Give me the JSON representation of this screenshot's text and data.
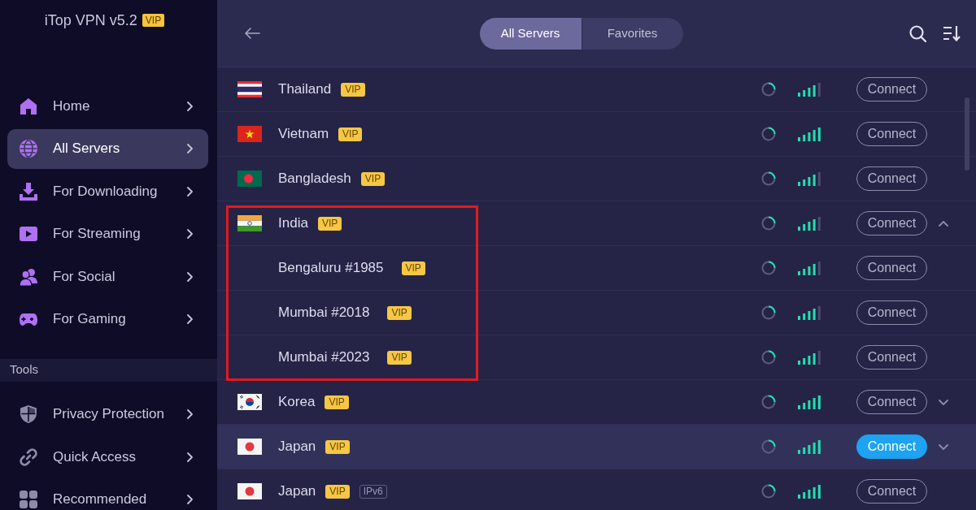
{
  "app": {
    "title": "iTop VPN v5.2",
    "badge": "VIP"
  },
  "sidebar": {
    "items": [
      {
        "label": "Home",
        "selected": false
      },
      {
        "label": "All Servers",
        "selected": true
      },
      {
        "label": "For Downloading",
        "selected": false
      },
      {
        "label": "For Streaming",
        "selected": false
      },
      {
        "label": "For Social",
        "selected": false
      },
      {
        "label": "For Gaming",
        "selected": false
      }
    ]
  },
  "tools": {
    "heading": "Tools",
    "items": [
      {
        "label": "Privacy Protection",
        "selected": false
      },
      {
        "label": "Quick Access",
        "selected": false
      },
      {
        "label": "Recommended",
        "selected": false
      }
    ]
  },
  "toolbar": {
    "tabs": [
      {
        "label": "All Servers",
        "selected": true
      },
      {
        "label": "Favorites",
        "selected": false
      }
    ]
  },
  "servers": [
    {
      "name": "Thailand",
      "tags": [
        {
          "kind": "vip",
          "label": "VIP"
        }
      ],
      "full_signal": false,
      "hovered": false,
      "outlined": false,
      "action": "Connect"
    },
    {
      "name": "Vietnam",
      "tags": [
        {
          "kind": "vip",
          "label": "VIP"
        }
      ],
      "full_signal": true,
      "hovered": false,
      "outlined": false,
      "action": "Connect"
    },
    {
      "name": "Bangladesh",
      "tags": [
        {
          "kind": "vip",
          "label": "VIP"
        }
      ],
      "full_signal": false,
      "hovered": false,
      "outlined": false,
      "action": "Connect"
    },
    {
      "name": "India",
      "tags": [
        {
          "kind": "vip",
          "label": "VIP"
        }
      ],
      "full_signal": false,
      "hovered": false,
      "outlined": true,
      "action": "Connect",
      "expanded": true,
      "children": [
        {
          "name": "Bengaluru #1985",
          "tags": [
            {
              "kind": "vip",
              "label": "VIP"
            }
          ],
          "full_signal": false,
          "hovered": false,
          "action": "Connect"
        },
        {
          "name": "Mumbai #2018",
          "tags": [
            {
              "kind": "vip",
              "label": "VIP"
            }
          ],
          "full_signal": false,
          "hovered": false,
          "action": "Connect"
        },
        {
          "name": "Mumbai #2023",
          "tags": [
            {
              "kind": "vip",
              "label": "VIP"
            }
          ],
          "full_signal": false,
          "hovered": false,
          "action": "Connect"
        }
      ]
    },
    {
      "name": "Korea",
      "tags": [
        {
          "kind": "vip",
          "label": "VIP"
        }
      ],
      "full_signal": true,
      "hovered": false,
      "outlined": false,
      "action": "Connect",
      "expanded": false
    },
    {
      "name": "Japan",
      "tags": [
        {
          "kind": "vip",
          "label": "VIP"
        }
      ],
      "full_signal": true,
      "hovered": true,
      "outlined": false,
      "action": "Connect",
      "expanded": false
    },
    {
      "name": "Japan",
      "tags": [
        {
          "kind": "vip",
          "label": "VIP"
        },
        {
          "kind": "protocol",
          "label": "IPv6"
        }
      ],
      "full_signal": true,
      "hovered": false,
      "outlined": false,
      "action": "Connect"
    }
  ]
}
